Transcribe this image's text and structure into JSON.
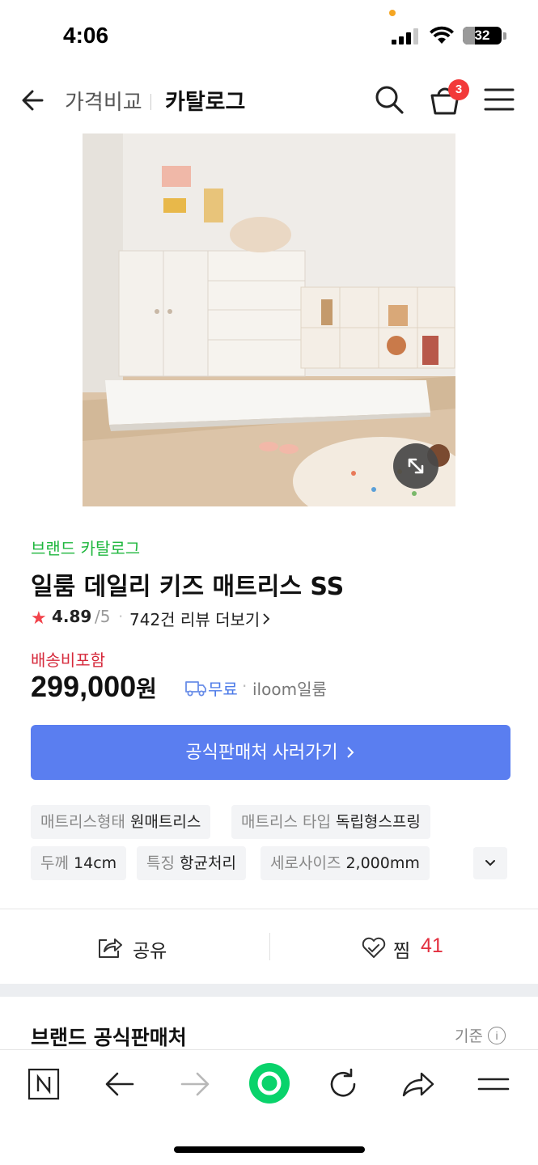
{
  "status_bar": {
    "time": "4:06",
    "battery_pct": "32",
    "battery_level": 0.32
  },
  "topnav": {
    "crumb_compare": "가격비교",
    "crumb_catalog": "카탈로그",
    "cart_count": "3"
  },
  "product": {
    "brand_link": "브랜드 카탈로그",
    "title": "일룸 데일리 키즈 매트리스 SS",
    "rating": "4.89",
    "rating_max": "/5",
    "review_link": "742건 리뷰 더보기",
    "shipping_label": "배송비포함",
    "price_amount": "299,000",
    "price_unit": "원",
    "shipping_free": "무료",
    "seller": "iloom일룸",
    "buy_button": "공식판매처 사러가기"
  },
  "specs": [
    {
      "key": "매트리스형태",
      "value": "원매트리스"
    },
    {
      "key": "매트리스 타입",
      "value": "독립형스프링"
    },
    {
      "key": "두께",
      "value": "14cm"
    },
    {
      "key": "특징",
      "value": "항균처리"
    },
    {
      "key": "세로사이즈",
      "value": "2,000mm"
    }
  ],
  "actions": {
    "share_label": "공유",
    "wish_label": "찜",
    "wish_count": "41"
  },
  "section": {
    "title": "브랜드 공식판매처",
    "criteria_label": "기준"
  },
  "colors": {
    "accent_blue": "#5a7ef0",
    "brand_green": "#1fb73e",
    "price_red": "#d62a3c",
    "badge_red": "#f23a3a",
    "naver_green": "#09d36b"
  },
  "toolbar": {
    "icons": [
      "naver-home-icon",
      "back-arrow-icon",
      "forward-arrow-icon",
      "green-dot-icon",
      "reload-icon",
      "share-arrow-icon",
      "menu-icon"
    ]
  }
}
